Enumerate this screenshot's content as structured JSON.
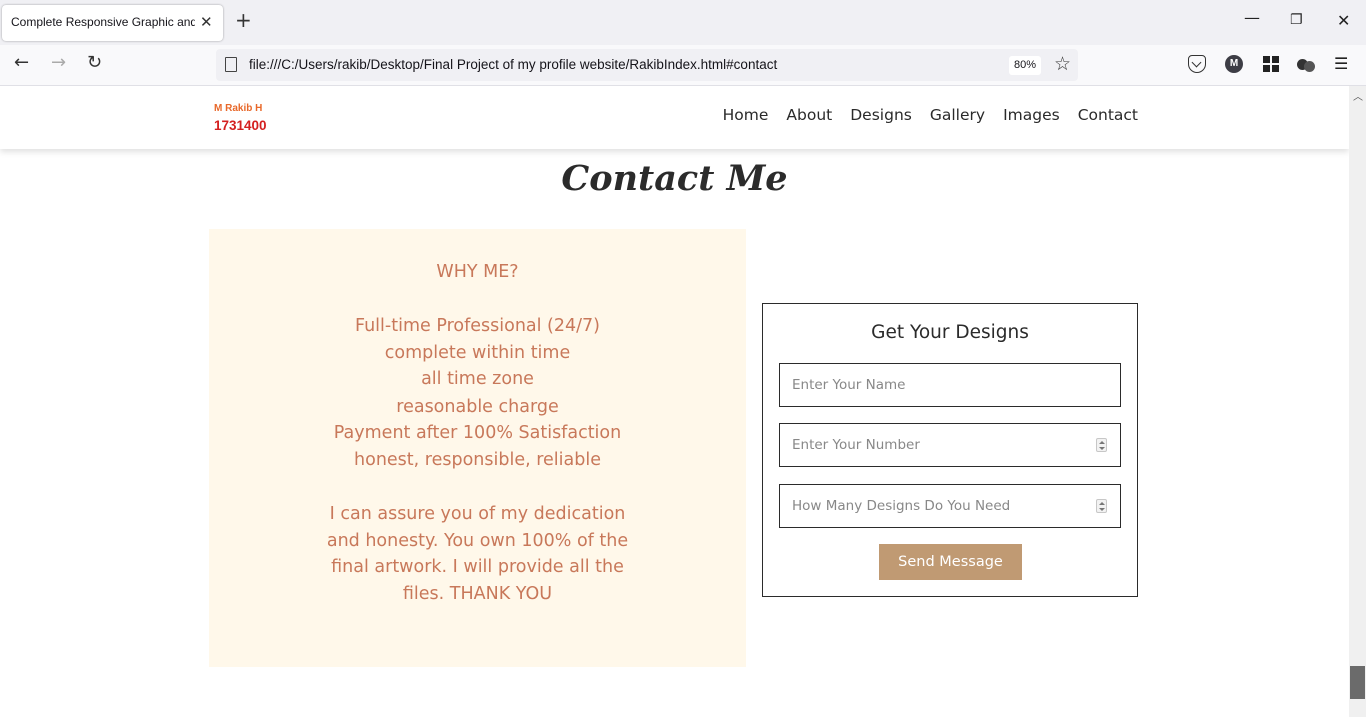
{
  "browser": {
    "tab_title": "Complete Responsive Graphic and W",
    "tab_close_icon": "close-icon",
    "new_tab_icon": "plus-icon",
    "url": "file:///C:/Users/rakib/Desktop/Final Project of my profile website/RakibIndex.html#contact",
    "zoom": "80%",
    "extensions": [
      "pocket-icon",
      "account-icon",
      "apps-grid-icon",
      "extension-icon",
      "menu-icon"
    ],
    "account_letter": "M"
  },
  "site": {
    "logo_name": "M Rakib H",
    "logo_id": "1731400",
    "nav": [
      "Home",
      "About",
      "Designs",
      "Gallery",
      "Images",
      "Contact"
    ],
    "section_title": "Contact Me",
    "why_me": {
      "lines": [
        "WHY ME?",
        "Full-time Professional (24/7)",
        "complete within time",
        "all time zone",
        "reasonable charge",
        "Payment after 100% Satisfaction",
        "honest, responsible, reliable",
        "I can assure you of my dedication",
        "and honesty. You own 100% of the",
        "final artwork. I will provide all the",
        "files. THANK YOU"
      ]
    },
    "form": {
      "title": "Get Your Designs",
      "name_placeholder": "Enter Your Name",
      "number_placeholder": "Enter Your Number",
      "designs_placeholder": "How Many Designs Do You Need",
      "submit_label": "Send Message"
    }
  },
  "colors": {
    "logo_name": "#e8682a",
    "logo_id": "#d42020",
    "why_me_bg": "#fff8ea",
    "why_me_text": "#c8785a",
    "button_bg": "#c09a73"
  }
}
